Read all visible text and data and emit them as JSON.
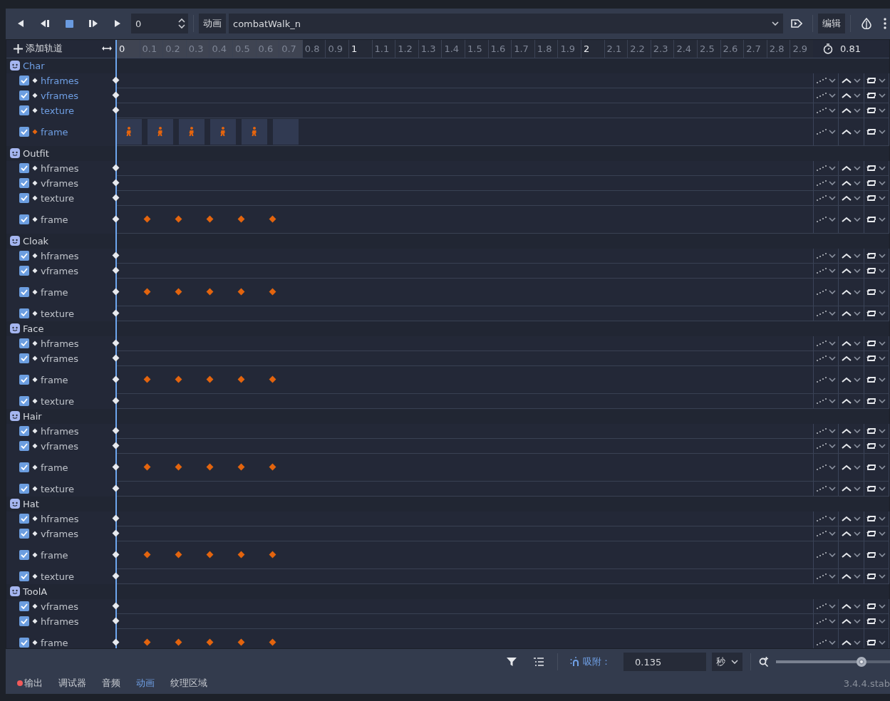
{
  "toolbar": {
    "frame_value": "0",
    "animation_button": "动画",
    "animation": "combatWalk_n",
    "edit_button": "编辑"
  },
  "add_track": "添加轨道",
  "ruler": [
    {
      "label": "0",
      "in_range": true,
      "major": true
    },
    {
      "label": "0.1",
      "in_range": true,
      "major": false
    },
    {
      "label": "0.2",
      "in_range": true,
      "major": false
    },
    {
      "label": "0.3",
      "in_range": true,
      "major": false
    },
    {
      "label": "0.4",
      "in_range": true,
      "major": false
    },
    {
      "label": "0.5",
      "in_range": true,
      "major": false
    },
    {
      "label": "0.6",
      "in_range": true,
      "major": false
    },
    {
      "label": "0.7",
      "in_range": true,
      "major": false
    },
    {
      "label": "0.8",
      "in_range": false,
      "major": false
    },
    {
      "label": "0.9",
      "in_range": false,
      "major": false
    },
    {
      "label": "1",
      "in_range": false,
      "major": true
    },
    {
      "label": "1.1",
      "in_range": false,
      "major": false
    },
    {
      "label": "1.2",
      "in_range": false,
      "major": false
    },
    {
      "label": "1.3",
      "in_range": false,
      "major": false
    },
    {
      "label": "1.4",
      "in_range": false,
      "major": false
    },
    {
      "label": "1.5",
      "in_range": false,
      "major": false
    },
    {
      "label": "1.6",
      "in_range": false,
      "major": false
    },
    {
      "label": "1.7",
      "in_range": false,
      "major": false
    },
    {
      "label": "1.8",
      "in_range": false,
      "major": false
    },
    {
      "label": "1.9",
      "in_range": false,
      "major": false
    },
    {
      "label": "2",
      "in_range": false,
      "major": true
    },
    {
      "label": "2.1",
      "in_range": false,
      "major": false
    },
    {
      "label": "2.2",
      "in_range": false,
      "major": false
    },
    {
      "label": "2.3",
      "in_range": false,
      "major": false
    },
    {
      "label": "2.4",
      "in_range": false,
      "major": false
    },
    {
      "label": "2.5",
      "in_range": false,
      "major": false
    },
    {
      "label": "2.6",
      "in_range": false,
      "major": false
    },
    {
      "label": "2.7",
      "in_range": false,
      "major": false
    },
    {
      "label": "2.8",
      "in_range": false,
      "major": false
    },
    {
      "label": "2.9",
      "in_range": false,
      "major": false
    }
  ],
  "length": "0.81",
  "groups": [
    {
      "name": "Char",
      "selected": true,
      "tracks": [
        {
          "name": "hframes",
          "kind": "value",
          "checked": true
        },
        {
          "name": "vframes",
          "kind": "value",
          "checked": true
        },
        {
          "name": "texture",
          "kind": "value",
          "checked": true
        },
        {
          "name": "frame",
          "kind": "sprite",
          "checked": true
        }
      ]
    },
    {
      "name": "Outfit",
      "selected": false,
      "tracks": [
        {
          "name": "hframes",
          "kind": "value",
          "checked": true
        },
        {
          "name": "vframes",
          "kind": "value",
          "checked": true
        },
        {
          "name": "texture",
          "kind": "value",
          "checked": true
        },
        {
          "name": "frame",
          "kind": "keys",
          "checked": true
        }
      ]
    },
    {
      "name": "Cloak",
      "selected": false,
      "tracks": [
        {
          "name": "hframes",
          "kind": "value",
          "checked": true
        },
        {
          "name": "vframes",
          "kind": "value",
          "checked": true
        },
        {
          "name": "frame",
          "kind": "keys",
          "checked": true
        },
        {
          "name": "texture",
          "kind": "value",
          "checked": true
        }
      ]
    },
    {
      "name": "Face",
      "selected": false,
      "tracks": [
        {
          "name": "hframes",
          "kind": "value",
          "checked": true
        },
        {
          "name": "vframes",
          "kind": "value",
          "checked": true
        },
        {
          "name": "frame",
          "kind": "keys",
          "checked": true
        },
        {
          "name": "texture",
          "kind": "value",
          "checked": true
        }
      ]
    },
    {
      "name": "Hair",
      "selected": false,
      "tracks": [
        {
          "name": "hframes",
          "kind": "value",
          "checked": true
        },
        {
          "name": "vframes",
          "kind": "value",
          "checked": true
        },
        {
          "name": "frame",
          "kind": "keys",
          "checked": true
        },
        {
          "name": "texture",
          "kind": "value",
          "checked": true
        }
      ]
    },
    {
      "name": "Hat",
      "selected": false,
      "tracks": [
        {
          "name": "hframes",
          "kind": "value",
          "checked": true
        },
        {
          "name": "vframes",
          "kind": "value",
          "checked": true
        },
        {
          "name": "frame",
          "kind": "keys",
          "checked": true
        },
        {
          "name": "texture",
          "kind": "value",
          "checked": true
        }
      ]
    },
    {
      "name": "ToolA",
      "selected": false,
      "tracks": [
        {
          "name": "vframes",
          "kind": "value",
          "checked": true
        },
        {
          "name": "hframes",
          "kind": "value",
          "checked": true
        },
        {
          "name": "frame",
          "kind": "keys",
          "checked": true
        }
      ]
    }
  ],
  "bottom_bar": {
    "snap_label": "吸附：",
    "snap_value": "0.135",
    "unit": "秒",
    "zoom": {
      "level": 0.75
    }
  },
  "bottom_tabs": [
    {
      "label": "输出",
      "selected": false,
      "alert": true
    },
    {
      "label": "调试器",
      "selected": false,
      "alert": false
    },
    {
      "label": "音频",
      "selected": false,
      "alert": false
    },
    {
      "label": "动画",
      "selected": true,
      "alert": false
    },
    {
      "label": "纹理区域",
      "selected": false,
      "alert": false
    }
  ],
  "version": "3.4.4.stab"
}
